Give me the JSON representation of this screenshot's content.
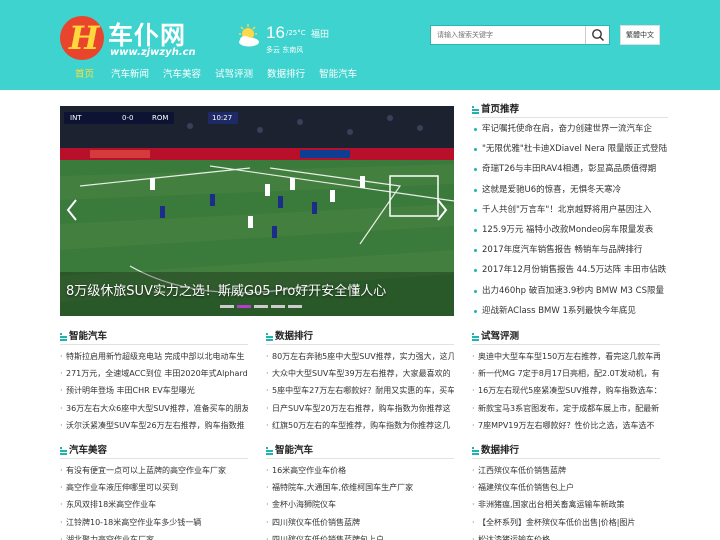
{
  "logo": {
    "title": "车仆网",
    "url": "www.zjwzyh.cn",
    "mark": "H"
  },
  "weather": {
    "temp": "16",
    "unit": "/25°C",
    "city": "福田",
    "desc": "多云 东南风",
    "icon": "sun-cloud-icon"
  },
  "search": {
    "placeholder": "请输入搜索关键字",
    "button_icon": "search-icon"
  },
  "lang_button": "繁體中文",
  "nav": [
    {
      "label": "首页",
      "active": true
    },
    {
      "label": "汽车新闻"
    },
    {
      "label": "汽车美容"
    },
    {
      "label": "试驾评测"
    },
    {
      "label": "数据排行"
    },
    {
      "label": "智能汽车"
    }
  ],
  "slider": {
    "caption": "8万级休旅SUV实力之选！斯威G05 Pro好开安全懂人心",
    "score_left": "INT",
    "score": "0-0",
    "score_right": "ROM",
    "clock": "10:27",
    "dots": 5,
    "active_dot": 1
  },
  "recommended": {
    "title": "首页推荐",
    "items": [
      "牢记嘱托使命在肩，奋力创建世界一流汽车企",
      "\"无限优雅\"杜卡迪XDiavel Nera 限量版正式登陆",
      "奇瑞T26与丰田RAV4相遇，彰显高品质值得期",
      "这就是爱驰U6的惊喜，无惧冬天寒冷",
      "千人共创\"万言车\"！北京越野将用户基因注入",
      "125.9万元 福特小改款Mondeo房车限量发表",
      "2017年度汽车销售报告 畅销车与品牌排行",
      "2017年12月份销售报告 44.5万达阵 丰田市佔跌",
      "出力460hp 破百加速3.9秒内 BMW M3 CS限量",
      "迎战新AClass BMW 1系列最快今年底见"
    ]
  },
  "blocks": [
    {
      "title": "智能汽车",
      "items": [
        "特斯拉启用新竹超级充电站 完成中部以北电动车生",
        "271万元，全速域ACC到位 丰田2020年式Alphard上",
        "预计明年登场 丰田CHR EV车型曝光",
        "36万左右大众6座中大型SUV推荐，准备买车的朋友",
        "沃尔沃紧凑型SUV车型26万左右推荐，购车指数推"
      ]
    },
    {
      "title": "数据排行",
      "items": [
        "80万左右奔驰5座中大型SUV推荐，实力强大，这几",
        "大众中大型SUV车型39万左右推荐，大家最喜欢的",
        "5座中型车27万左右哪款好？耐用又实惠的车，买车",
        "日产SUV车型20万左右推荐，购车指数为你推荐这",
        "红旗50万左右的车型推荐，购车指数为你推荐这几"
      ]
    },
    {
      "title": "试驾评测",
      "items": [
        "奥迪中大型车车型150万左右推荐，看完这几款车再",
        "新一代MG 7定于8月17日亮相，配2.0T发动机，有",
        "16万左右现代5座紧凑型SUV推荐，购车指数选车：",
        "新款宝马3系官图发布，定于成都车展上市，配最新",
        "7座MPV19万左右哪款好？性价比之选，选车选不"
      ]
    },
    {
      "title": "汽车美容",
      "items": [
        "有没有便宜一点可以上蓝牌的高空作业车厂家",
        "高空作业车液压伸哪里可以买到",
        "东风双排18米高空作业车",
        "江铃牌10-18米高空作业车多少钱一辆",
        "湖北聚力高空作业车厂家"
      ]
    },
    {
      "title": "智能汽车",
      "items": [
        "16米高空作业车价格",
        "福特院车,大通国车,依维柯国车生产厂家",
        "金杯小海狮院仪车",
        "四川殡仪车低价销售蓝牌",
        "四川殡仪车低价销售蓝牌包上户"
      ]
    },
    {
      "title": "数据排行",
      "items": [
        "江西殡仪车低价销售蓝牌",
        "福建殡仪车低价销售包上户",
        "非洲猪瘟,国家出台相关畜禽运输车新政策",
        "【全杯系列】金杯殡仪车低价出售|价格|图片",
        "松达漆猪运输车价格"
      ]
    }
  ],
  "colors": {
    "header": "#3fd3cf",
    "accent": "#1eb4b0",
    "nav_active": "#ffe033",
    "dot_active": "#b83cc9"
  }
}
